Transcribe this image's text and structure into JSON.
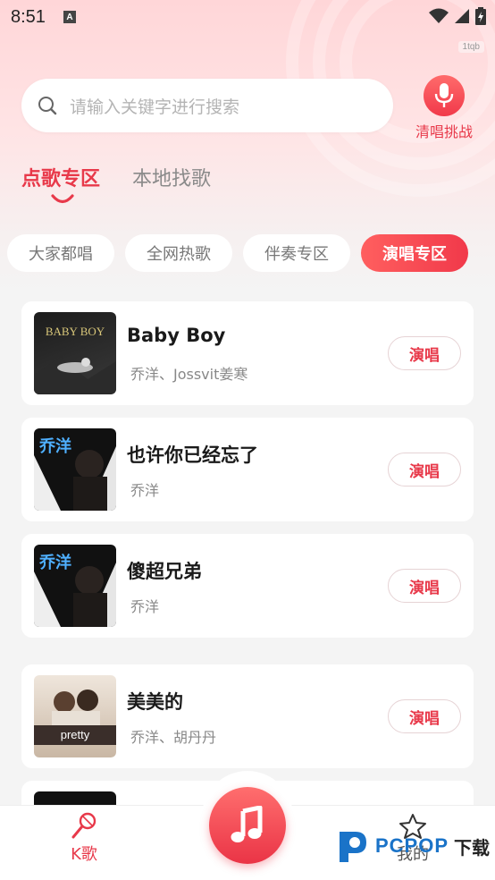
{
  "status_bar": {
    "time": "8:51",
    "notification_letter": "A"
  },
  "badge": "1tqb",
  "search": {
    "placeholder": "请输入关键字进行搜索"
  },
  "mic": {
    "label": "清唱挑战"
  },
  "main_tabs": [
    {
      "label": "点歌专区",
      "active": true
    },
    {
      "label": "本地找歌",
      "active": false
    }
  ],
  "chips": [
    {
      "label": "大家都唱",
      "active": false
    },
    {
      "label": "全网热歌",
      "active": false
    },
    {
      "label": "伴奏专区",
      "active": false
    },
    {
      "label": "演唱专区",
      "active": true
    }
  ],
  "songs": [
    {
      "title": "Baby Boy",
      "artist": "乔洋、Jossvit姜寒",
      "action": "演唱",
      "cover_text": "BABY BOY"
    },
    {
      "title": "也许你已经忘了",
      "artist": "乔洋",
      "action": "演唱",
      "cover_text": "乔洋"
    },
    {
      "title": "傻超兄弟",
      "artist": "乔洋",
      "action": "演唱",
      "cover_text": "乔洋"
    },
    {
      "title": "美美的",
      "artist": "乔洋、胡丹丹",
      "action": "演唱",
      "cover_text": "pretty"
    }
  ],
  "bottom_nav": {
    "k_label": "K歌",
    "me_label": "我的"
  },
  "watermark": {
    "brand": "PCPOP",
    "suffix": "下载"
  },
  "colors": {
    "accent": "#e8394a",
    "background": "#f4f4f4",
    "watermark_blue": "#1a73c8"
  }
}
